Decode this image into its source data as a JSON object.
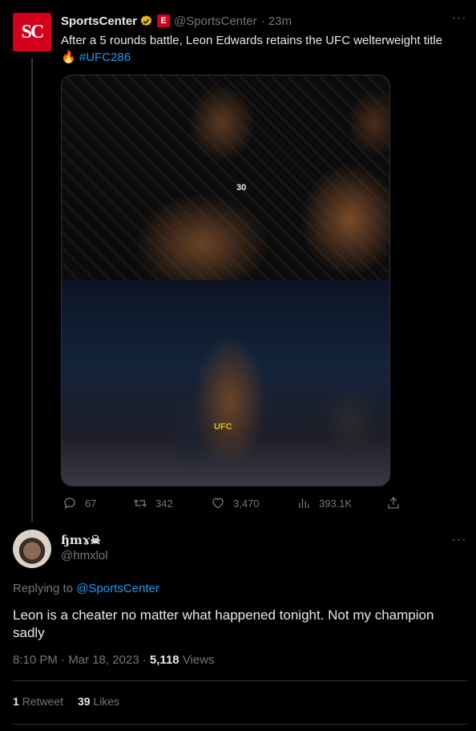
{
  "tweet1": {
    "author_name": "SportsCenter",
    "avatar_text": "SC",
    "badge_text": "E",
    "handle": "@SportsCenter",
    "time": "· 23m",
    "text": "After a 5 rounds battle, Leon Edwards retains the UFC welterweight title",
    "emoji": "🔥",
    "hashtag": "#UFC286",
    "image_label_1": "30",
    "image_label_2": "UFC",
    "replies": "67",
    "retweets": "342",
    "likes": "3,470",
    "views": "393.1K"
  },
  "tweet2": {
    "author_name": "ɧmɤ☠",
    "handle": "@hmxlol",
    "replying_prefix": "Replying to",
    "replying_to": "@SportsCenter",
    "text": "Leon is a cheater no matter what happened tonight. Not my champion sadly",
    "timestamp": "8:10 PM · Mar 18, 2023 ·",
    "views_count": "5,118",
    "views_label": "Views",
    "retweet_count": "1",
    "retweet_label": "Retweet",
    "likes_count": "39",
    "likes_label": "Likes"
  },
  "colors": {
    "background": "#000000",
    "accent": "#1d9bf0",
    "muted": "#71767b",
    "espn_red": "#d5001c"
  }
}
